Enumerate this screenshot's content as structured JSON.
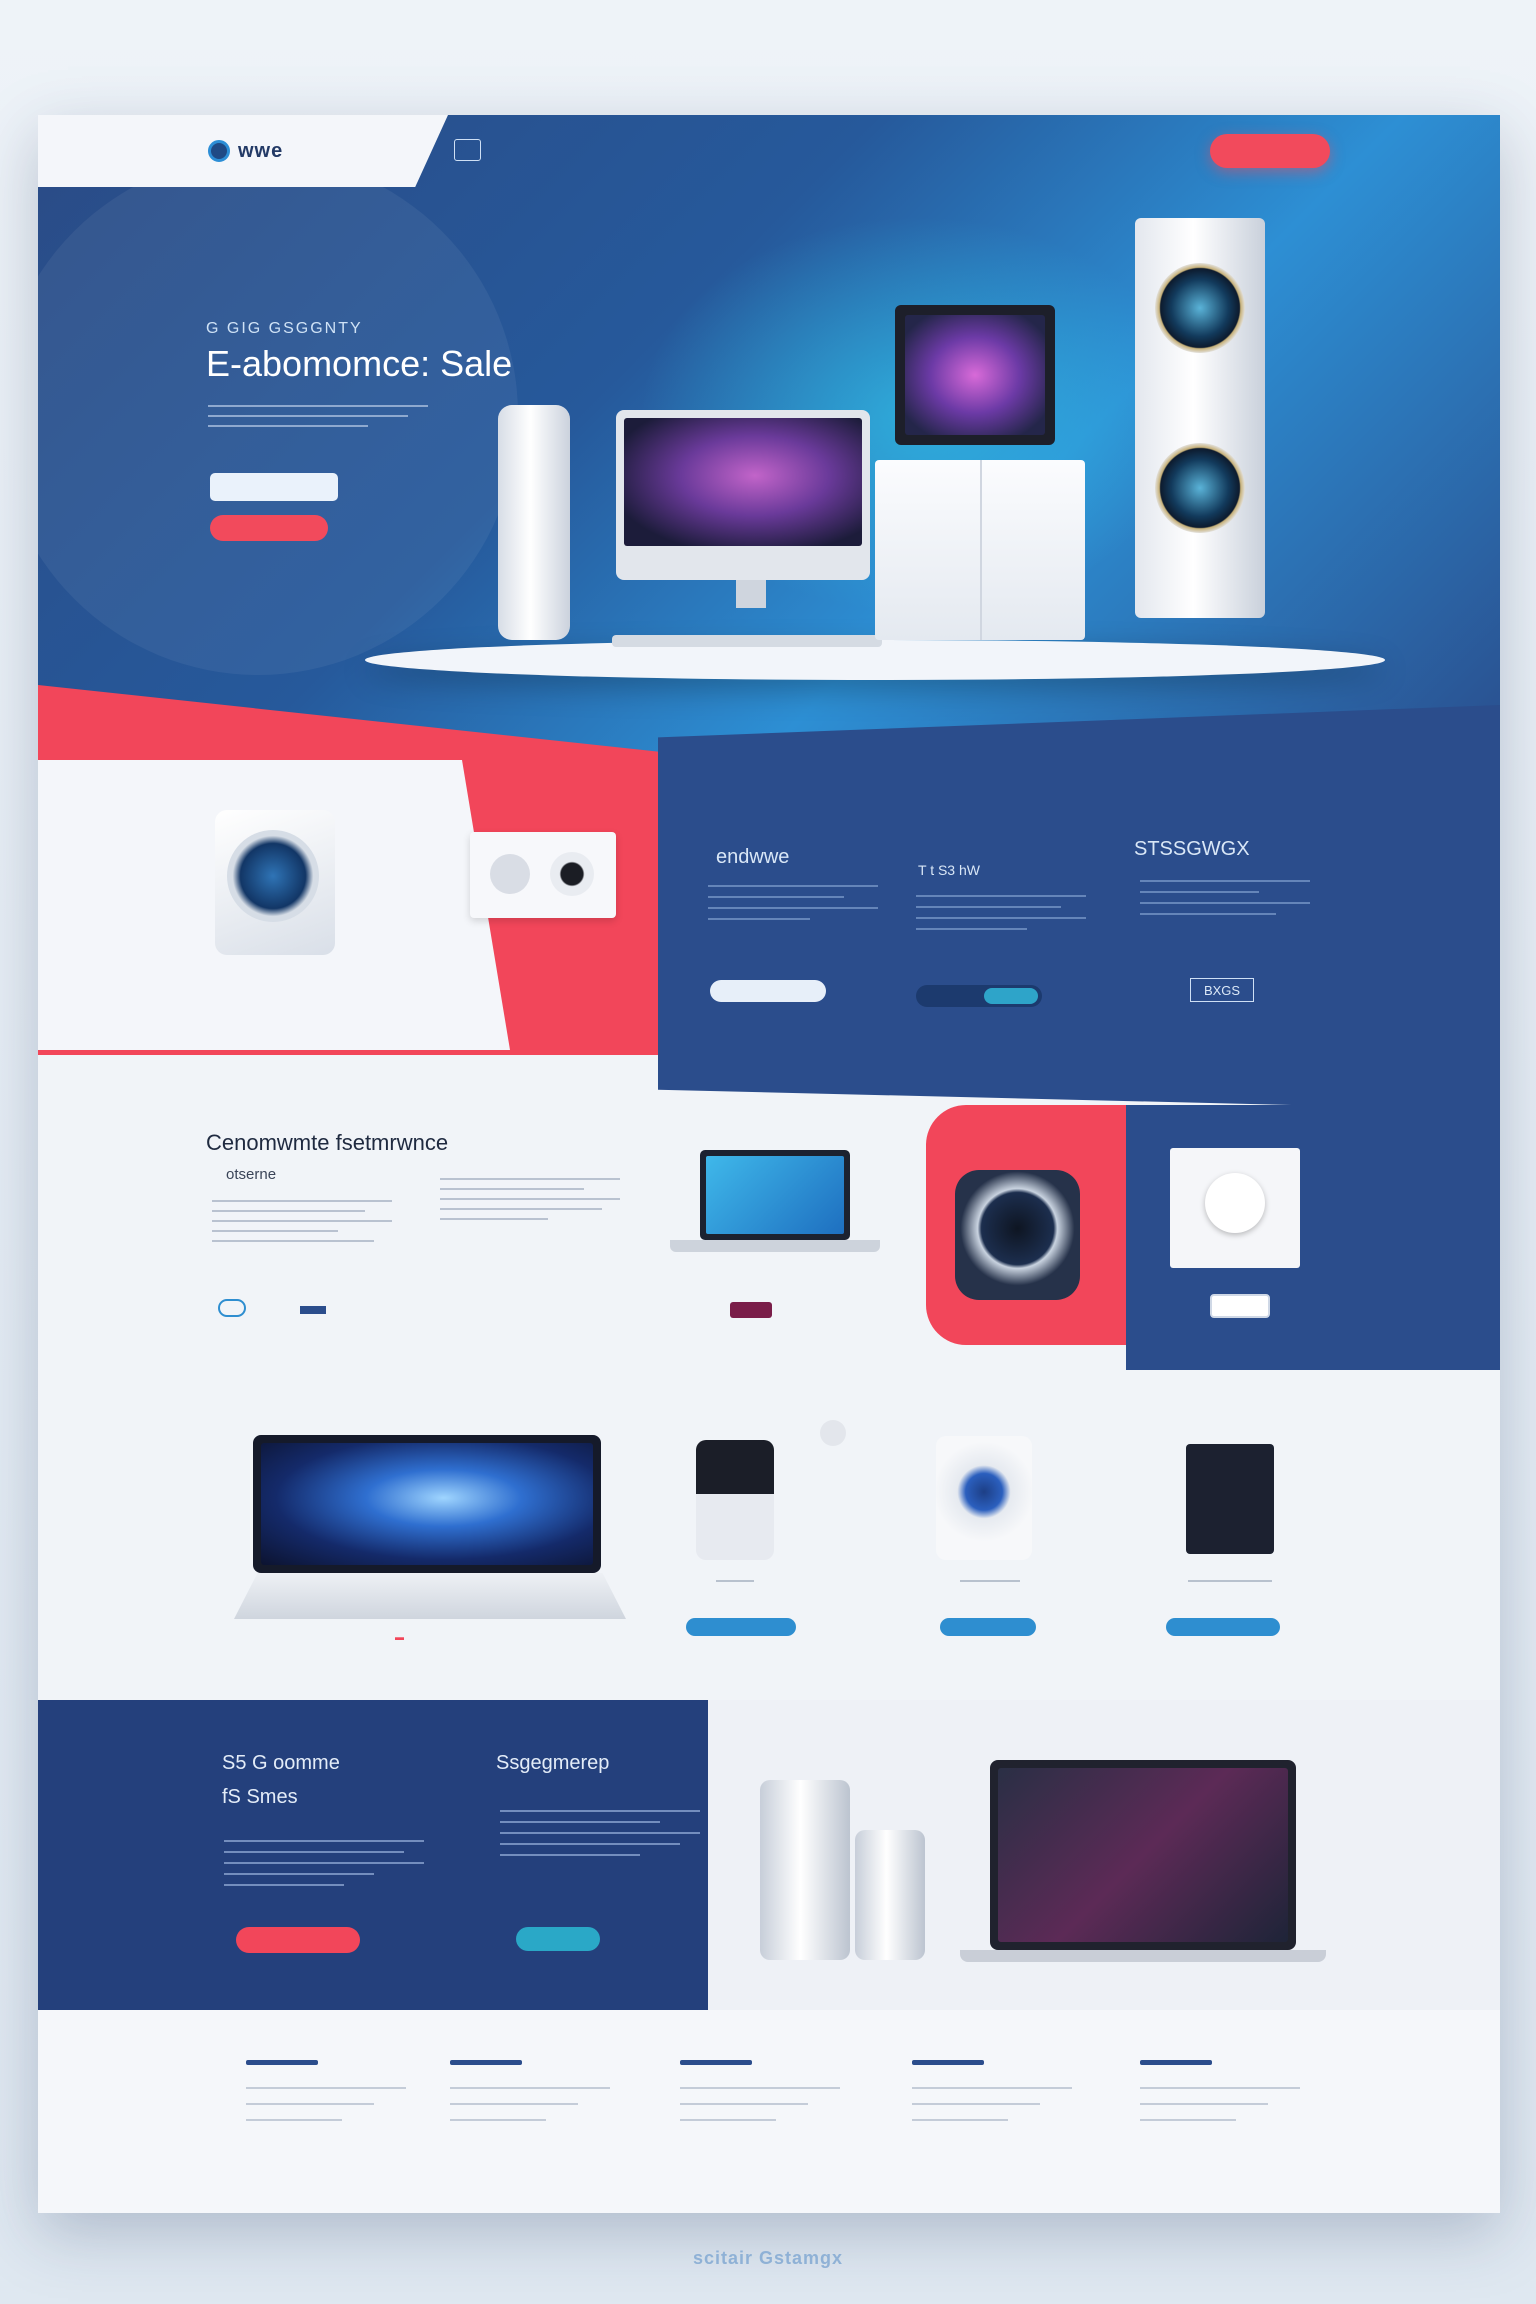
{
  "header": {
    "logo_text": "wwe",
    "nav": [
      "",
      "",
      "",
      "",
      "",
      "",
      "",
      ""
    ],
    "cta_label": ""
  },
  "hero": {
    "tagline": "G GIG GSGGNTY",
    "title": "E-abomomce: Sale",
    "button_primary": "",
    "button_secondary": ""
  },
  "features": {
    "col1_title": "endwwe",
    "col2_title": "T t  S3 hW",
    "col3_title": "STSSGWGX",
    "col3_badge": "BXGS"
  },
  "section3": {
    "title": "Cenomwmte fsetmrwnce",
    "subtitle": "otserne"
  },
  "section5": {
    "left_title_line1": "S5 G oomme",
    "left_title_line2": "fS Smes",
    "right_title": "Ssgegmerep"
  },
  "footer_brand": "scitair Gstamgx",
  "colors": {
    "navy": "#2b4d8c",
    "accent_red": "#f2465a",
    "accent_blue": "#2e8ed0",
    "background": "#f1f4f8"
  }
}
